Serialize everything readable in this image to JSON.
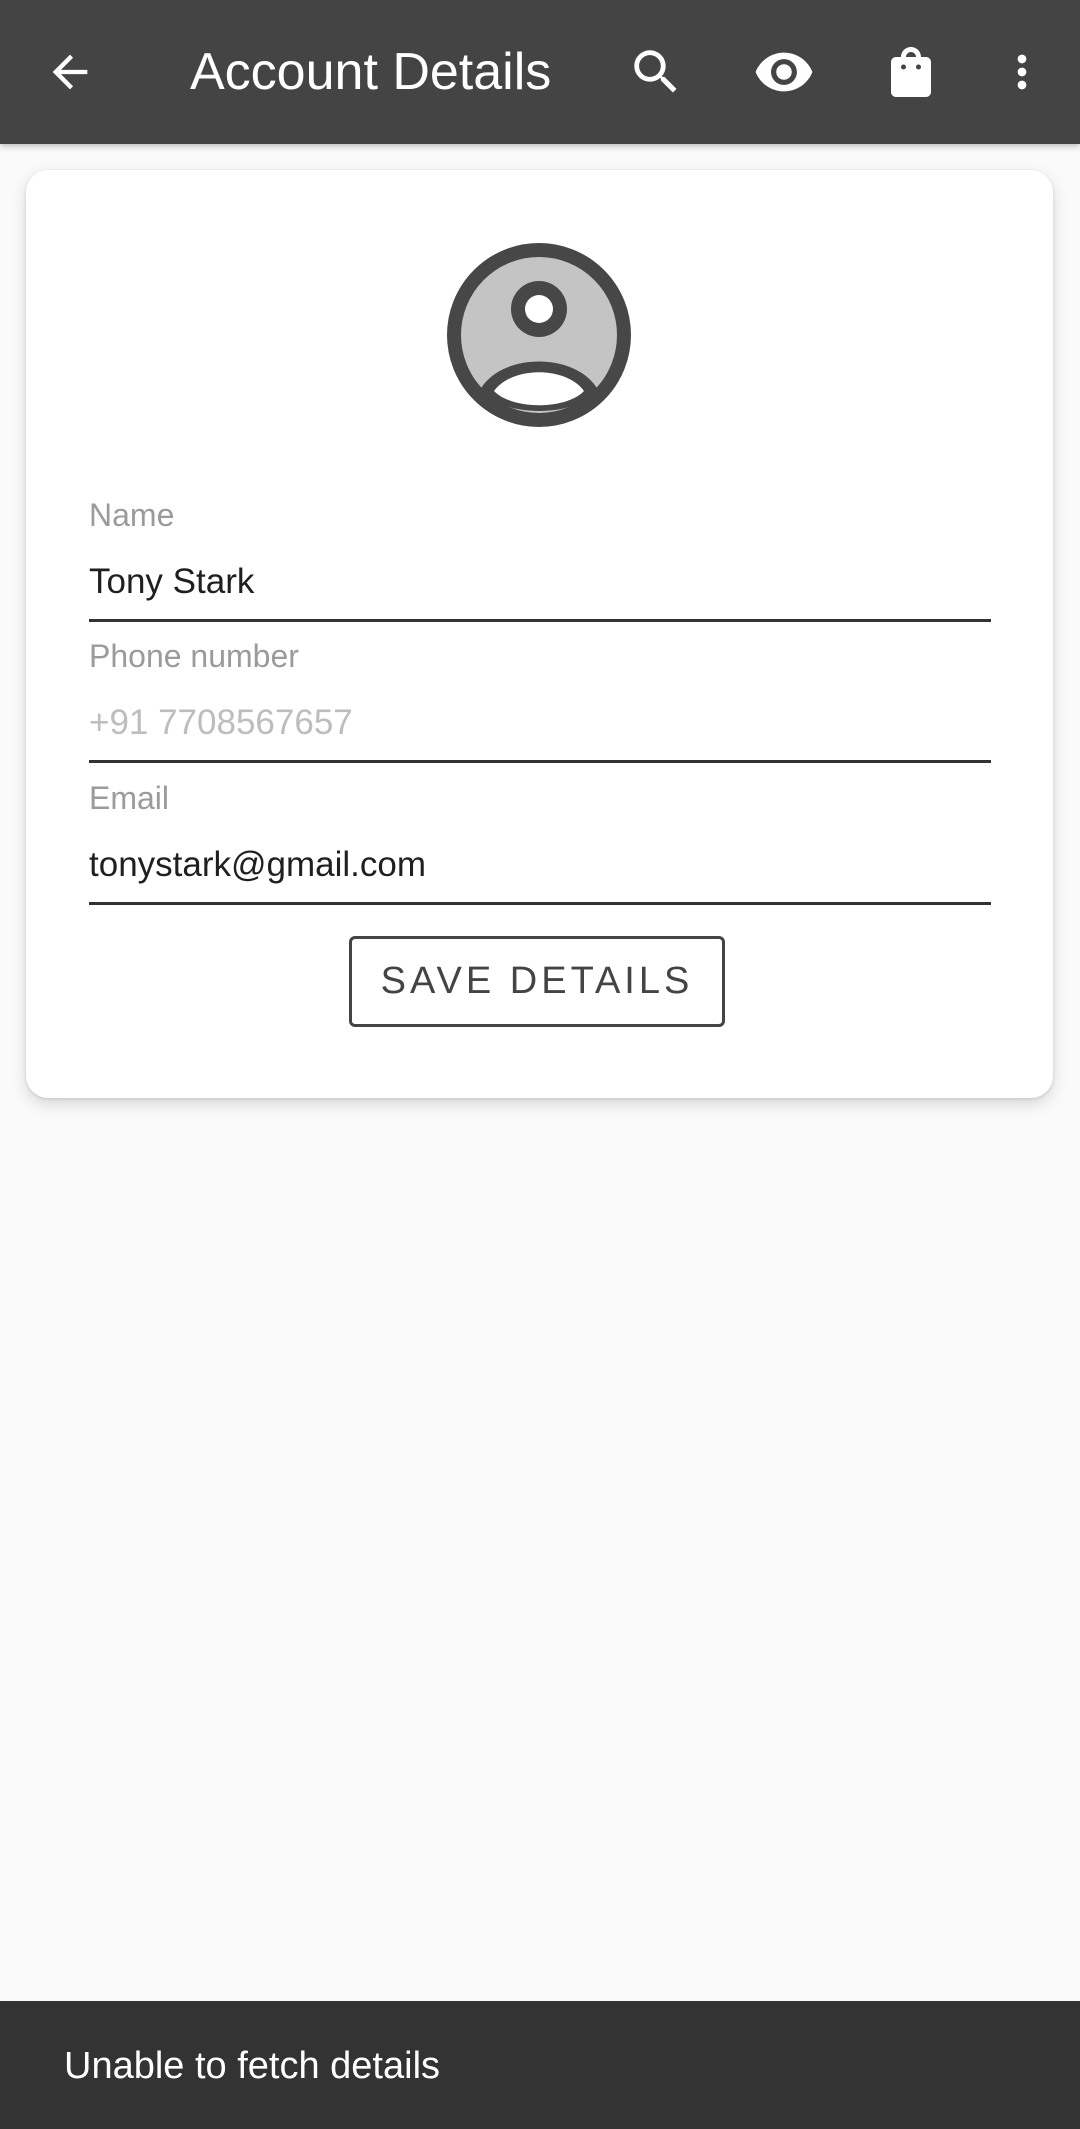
{
  "appbar": {
    "title": "Account Details",
    "icons": [
      "back-arrow-icon",
      "search-icon",
      "eye-icon",
      "shopping-bag-icon",
      "more-vert-icon"
    ],
    "background": "#444444"
  },
  "profile": {
    "avatar_icon": "account-circle-icon"
  },
  "form": {
    "name": {
      "label": "Name",
      "value": "Tony Stark"
    },
    "phone": {
      "label": "Phone number",
      "value": "",
      "placeholder": "+91 7708567657"
    },
    "email": {
      "label": "Email",
      "value": "tonystark@gmail.com"
    },
    "save_label": "SAVE DETAILS"
  },
  "snackbar": {
    "message": "Unable to fetch details"
  }
}
